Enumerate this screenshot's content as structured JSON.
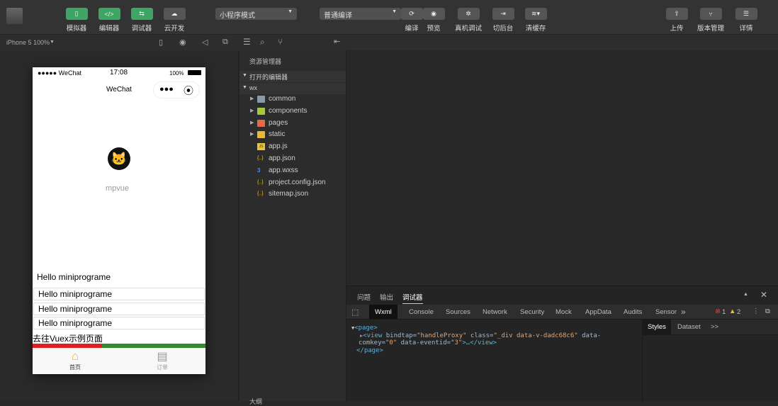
{
  "toolbar": {
    "buttons": [
      {
        "label": "模拟器",
        "icon": "phone-icon"
      },
      {
        "label": "编辑器",
        "icon": "code-icon"
      },
      {
        "label": "调试器",
        "icon": "debug-icon"
      },
      {
        "label": "云开发",
        "icon": "cloud-icon"
      }
    ],
    "mode_select": "小程序模式",
    "compile_select": "普通编译",
    "compile": "编译",
    "preview": "预览",
    "remote_debug": "真机调试",
    "background": "切后台",
    "clear_cache": "清缓存",
    "upload": "上传",
    "version": "版本管理",
    "details": "详情"
  },
  "simulator": {
    "device": "iPhone 5 100%",
    "status_left": "●●●●● WeChat",
    "time": "17:08",
    "battery": "100%",
    "nav_title": "WeChat",
    "logo_text": "mpvue",
    "hello_main": "Hello miniprograme",
    "hello_items": [
      "Hello miniprograme",
      "Hello miniprograme",
      "Hello miniprograme"
    ],
    "vuex_link": "去往Vuex示例页面",
    "tabbar": [
      {
        "label": "首页",
        "icon": "home-icon"
      },
      {
        "label": "订单",
        "icon": "order-icon"
      }
    ]
  },
  "explorer": {
    "title": "资源管理器",
    "open_editors": "打开的编辑器",
    "root": "wx",
    "items": [
      {
        "name": "common",
        "type": "folder",
        "color": "#8a9aa8"
      },
      {
        "name": "components",
        "type": "folder",
        "color": "#a5c73a"
      },
      {
        "name": "pages",
        "type": "folder",
        "color": "#e8664a"
      },
      {
        "name": "static",
        "type": "folder",
        "color": "#e8b73a"
      },
      {
        "name": "app.js",
        "type": "js"
      },
      {
        "name": "app.json",
        "type": "json"
      },
      {
        "name": "app.wxss",
        "type": "css"
      },
      {
        "name": "project.config.json",
        "type": "json"
      },
      {
        "name": "sitemap.json",
        "type": "json"
      }
    ],
    "outline": "大纲"
  },
  "debugger": {
    "top_tabs": [
      "问题",
      "输出",
      "调试器"
    ],
    "tabs": [
      "Wxml",
      "Console",
      "Sources",
      "Network",
      "Security",
      "Mock",
      "AppData",
      "Audits",
      "Sensor"
    ],
    "more": "»",
    "errors": "1",
    "warnings": "2",
    "side_tabs": [
      "Styles",
      "Dataset",
      ">>"
    ],
    "code": {
      "l1": "<page>",
      "l2a": "<view ",
      "l2b": "bindtap=",
      "l2c": "\"handleProxy\"",
      "l2d": " class=",
      "l2e": "\"_div data-v-dadc68c6\"",
      "l2f": " data-",
      "l3a": "comkey=",
      "l3b": "\"0\"",
      "l3c": " data-eventid=",
      "l3d": "\"3\"",
      "l3e": ">…</view>",
      "l4": "</page>"
    }
  },
  "colors": {
    "accent": "#3ea665",
    "progress_red": "#e02020",
    "progress_green": "#2e8b2e"
  }
}
